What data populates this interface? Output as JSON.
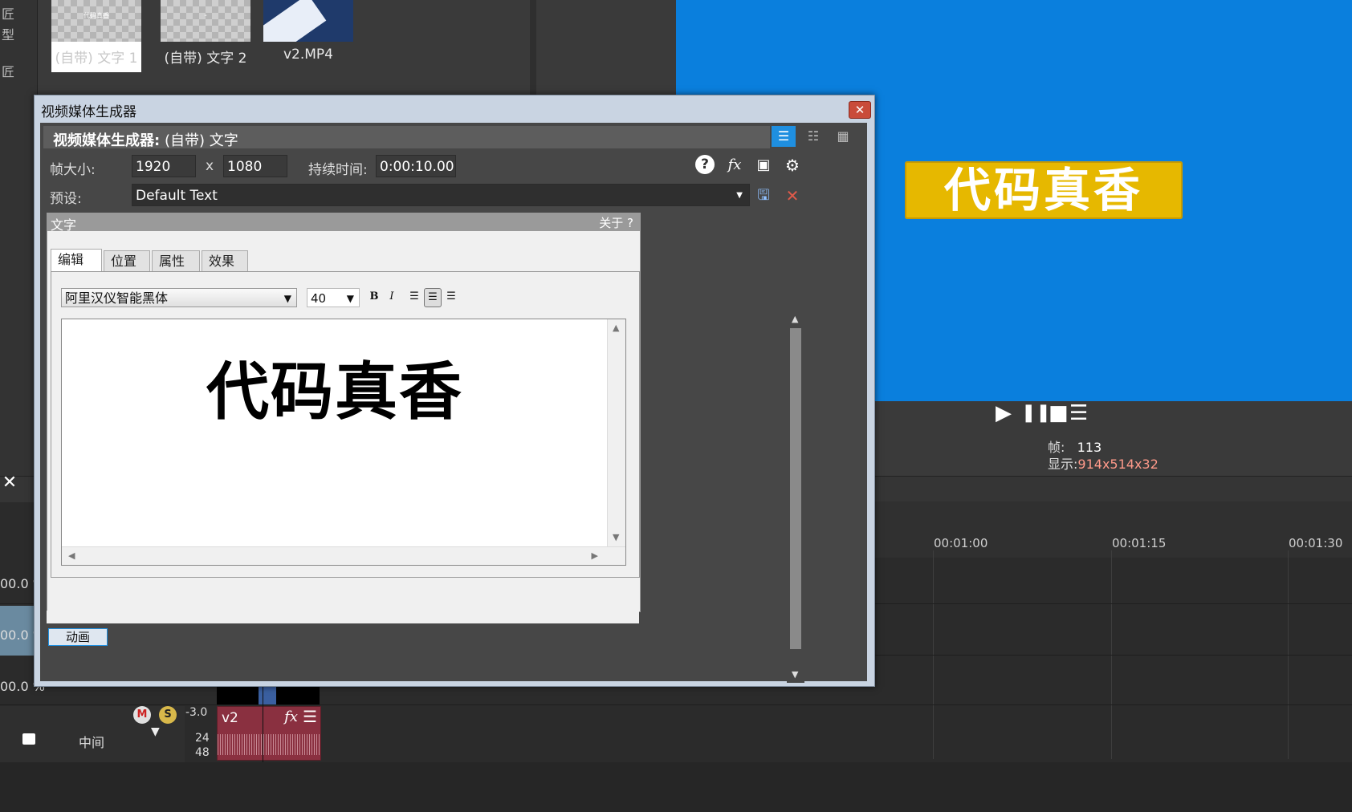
{
  "left_strip": {
    "chars": [
      "匠",
      "型",
      "匠"
    ]
  },
  "media": {
    "items": [
      {
        "name": "(自带) 文字 1",
        "thumb_text": "代码真香"
      },
      {
        "name": "(自带) 文字 2",
        "thumb_text": "-"
      },
      {
        "name": "v2.MP4"
      }
    ]
  },
  "preview": {
    "banner_text": "代码真香",
    "banner_color": "#e6b800",
    "background_color": "#0a7fdd",
    "frame_label": "帧:",
    "frame_value": "113",
    "display_label": "显示:",
    "display_value": "914x514x32"
  },
  "transport": {
    "play": "▶",
    "pause": "❚❚",
    "stop": "■",
    "menu": "☰"
  },
  "timeline": {
    "close": "✕",
    "ticks": [
      "00:01:00",
      "00:01:15",
      "00:01:30"
    ],
    "track_pcts": [
      "00.0 %",
      "00.0 %",
      "00.0 %"
    ],
    "audio": {
      "db": "-3.0",
      "ch1": "24",
      "ch2": "48",
      "pan_label": "中间",
      "m_icon": "M",
      "s_icon": "S"
    },
    "clip": {
      "name": "v2",
      "fx": "fx",
      "menu": "☰"
    }
  },
  "dialog": {
    "title": "视频媒体生成器",
    "close": "✕",
    "generator_prefix": "视频媒体生成器:",
    "generator_name": "(自带) 文字",
    "frame_size_label": "帧大小:",
    "width": "1920",
    "x_label": "x",
    "height": "1080",
    "duration_label": "持续时间:",
    "duration": "0:00:10.00",
    "preset_label": "预设:",
    "preset": "Default Text",
    "icons": {
      "help": "?",
      "fx": "fx",
      "save": "💾",
      "delete": "✕",
      "gear": "⚙"
    },
    "text_panel": {
      "title": "文字",
      "about": "关于 ?",
      "tabs": [
        "编辑",
        "位置",
        "属性",
        "效果"
      ],
      "font": "阿里汉仪智能黑体",
      "size": "40",
      "bold": "B",
      "italic": "I",
      "content": "代码真香"
    },
    "animation_button": "动画"
  }
}
